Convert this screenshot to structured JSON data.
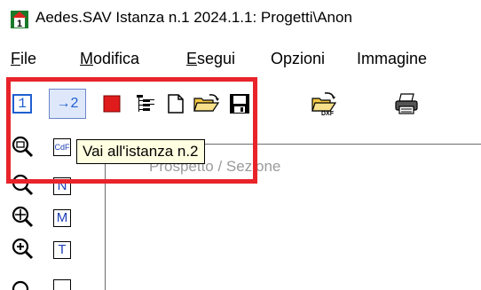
{
  "window": {
    "title": "Aedes.SAV Istanza n.1 2024.1.1: Progetti\\Anon"
  },
  "menu": {
    "items": [
      {
        "label": "File",
        "accel": "F"
      },
      {
        "label": "Modifica",
        "accel": "M"
      },
      {
        "label": "Esegui",
        "accel": "E"
      },
      {
        "label": "Opzioni",
        "accel": ""
      },
      {
        "label": "Immagine",
        "accel": ""
      }
    ]
  },
  "toolbar": {
    "instance1_label": "1",
    "instance2_label": "→2",
    "icons": [
      "stop-icon",
      "tree-icon",
      "new-file-icon",
      "open-folder-icon",
      "save-icon",
      "dxf-export-icon",
      "print-icon"
    ]
  },
  "left_toolbar": {
    "cdf_label": "CdF",
    "n_label": "N",
    "m_label": "M",
    "t_label": "T"
  },
  "canvas": {
    "watermark": "Prospetto / Sezione"
  },
  "tooltip": {
    "text": "Vai all'istanza n.2"
  },
  "colors": {
    "highlight": "#e8232a",
    "tooltip_bg": "#ffffe1",
    "accent_blue": "#1f5fd0",
    "stop_red": "#e01b1b"
  }
}
